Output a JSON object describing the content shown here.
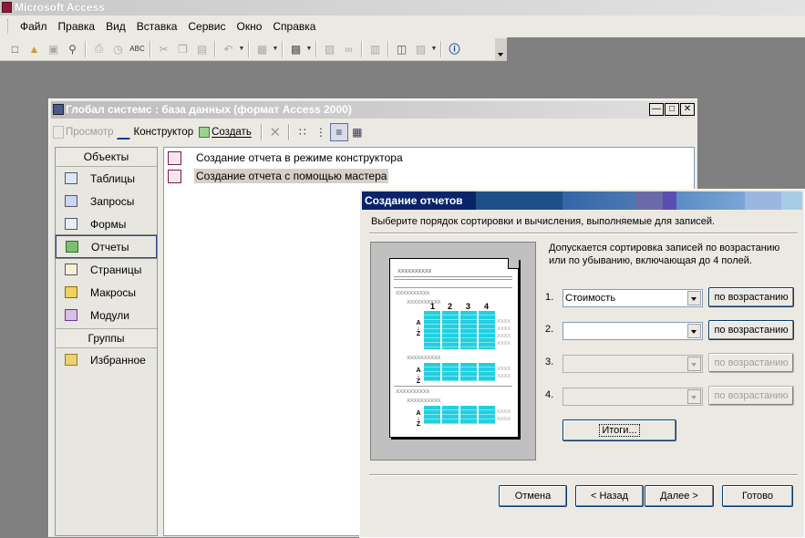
{
  "app": {
    "title": "Microsoft Access"
  },
  "menu": [
    "Файл",
    "Правка",
    "Вид",
    "Вставка",
    "Сервис",
    "Окно",
    "Справка"
  ],
  "db_window": {
    "title": "Глобал системс : база данных (формат Access 2000)",
    "toolbar": {
      "preview": "Просмотр",
      "designer": "Конструктор",
      "create": "Создать"
    },
    "objects_header": "Объекты",
    "objects": [
      "Таблицы",
      "Запросы",
      "Формы",
      "Отчеты",
      "Страницы",
      "Макросы",
      "Модули"
    ],
    "groups_header": "Группы",
    "groups": [
      "Избранное"
    ],
    "list": [
      "Создание отчета в режиме конструктора",
      "Создание отчета с помощью мастера"
    ]
  },
  "wizard": {
    "title": "Создание отчетов",
    "instruction": "Выберите порядок сортировки и вычисления, выполняемые для записей.",
    "description": "Допускается сортировка записей по возрастанию или по убыванию, включающая до 4 полей.",
    "preview": {
      "placeholder": "xxxxxxxxxx",
      "columns": [
        "1",
        "2",
        "3",
        "4"
      ]
    },
    "sorts": [
      {
        "num": "1.",
        "value": "Стоимость",
        "order": "по возрастанию"
      },
      {
        "num": "2.",
        "value": "",
        "order": "по возрастанию"
      },
      {
        "num": "3.",
        "value": "",
        "order": "по возрастанию"
      },
      {
        "num": "4.",
        "value": "",
        "order": "по возрастанию"
      }
    ],
    "totals_button": "Итоги...",
    "buttons": {
      "cancel": "Отмена",
      "back": "< Назад",
      "next": "Далее >",
      "finish": "Готово"
    }
  }
}
